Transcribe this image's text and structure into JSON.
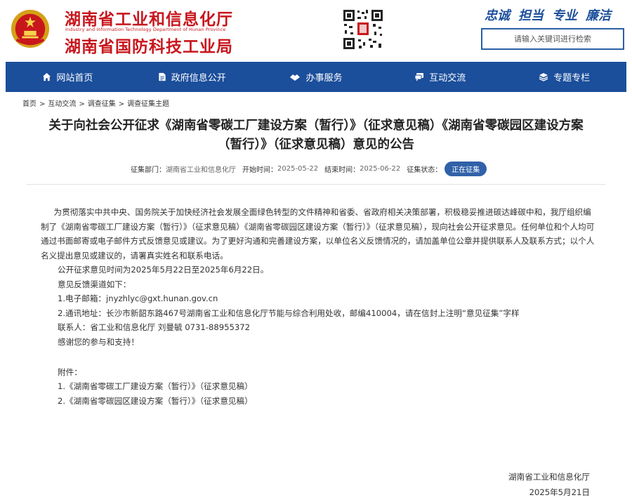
{
  "header": {
    "dept_name_1": "湖南省工业和信息化厅",
    "dept_name_en": "Industry and Information Technology Department of Hunan Province",
    "dept_name_2": "湖南省国防科技工业局",
    "slogans": [
      "忠诚",
      "担当",
      "专业",
      "廉洁"
    ],
    "search_placeholder": "请输入关键词进行检索",
    "emblem_icon": "national-emblem-icon",
    "qr_icon": "qr-code-icon"
  },
  "nav": {
    "items": [
      {
        "label": "网站首页",
        "icon": "home-icon"
      },
      {
        "label": "政府信息公开",
        "icon": "document-icon"
      },
      {
        "label": "办事服务",
        "icon": "service-icon"
      },
      {
        "label": "互动交流",
        "icon": "chat-icon"
      },
      {
        "label": "专题专栏",
        "icon": "layers-icon"
      }
    ],
    "background": "#1b4e9b"
  },
  "breadcrumb": [
    "首页",
    "互动交流",
    "调查征集",
    "调查征集主题"
  ],
  "article": {
    "title_line1": "关于向社会公开征求《湖南省零碳工厂建设方案（暂行）》（征求意见稿）《湖南省零碳园区建设方案",
    "title_line2": "（暂行）》（征求意见稿）意见的公告",
    "meta": {
      "dept_label": "征集部门：",
      "dept_value": "湖南省工业和信息化厅",
      "start_label": "开始时间：",
      "start_value": "2025-05-22",
      "end_label": "结束时间：",
      "end_value": "2025-06-22",
      "status_label": "征集状态：",
      "status_value": "正在征集"
    },
    "paragraph1": "为贯彻落实中共中央、国务院关于加快经济社会发展全面绿色转型的文件精神和省委、省政府相关决策部署，积极稳妥推进碳达峰碳中和，我厅组织编制了《湖南省零碳工厂建设方案（暂行）》（征求意见稿）《湖南省零碳园区建设方案（暂行）》（征求意见稿），现向社会公开征求意见。任何单位和个人均可通过书面邮寄或电子邮件方式反馈意见或建议。为了更好沟通和完善建设方案，以单位名义反馈情况的，请加盖单位公章并提供联系人及联系方式；以个人名义提出意见或建议的，请署真实姓名和联系电话。",
    "period": "公开征求意见时间为2025年5月22日至2025年6月22日。",
    "channels_intro": "意见反馈渠道如下：",
    "email_line": "1.电子邮箱：jnyzhlyc@gxt.hunan.gov.cn",
    "address_line": "2.通讯地址：长沙市新韶东路467号湖南省工业和信息化厅节能与综合利用处收，邮编410004，请在信封上注明“意见征集”字样",
    "contact_line": "联系人：省工业和信息化厅 刘曼毓 0731-88955372",
    "thanks": "感谢您的参与和支持！",
    "attachments_label": "附件：",
    "attachments": [
      "1.《湖南省零碳工厂建设方案（暂行）》（征求意见稿）",
      "2.《湖南省零碳园区建设方案（暂行）》（征求意见稿）"
    ],
    "signature_org": "湖南省工业和信息化厅",
    "signature_date": "2025年5月21日"
  }
}
